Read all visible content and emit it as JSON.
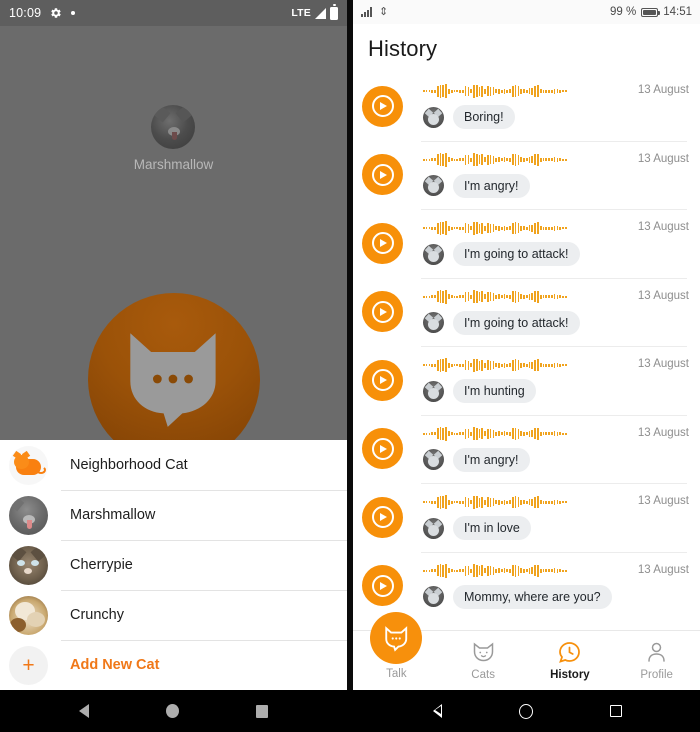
{
  "left_phone": {
    "status_bar": {
      "time": "10:09",
      "icons_left": [
        "gear-icon",
        "dot-icon"
      ],
      "network": "LTE",
      "icons_right": [
        "signal-icon",
        "battery-icon"
      ]
    },
    "hero": {
      "cat_name": "Marshmallow",
      "avatar": "cat-photo-avatar",
      "talk_button": "cat-speech-bubble-icon"
    },
    "cat_list": [
      {
        "label": "Neighborhood Cat",
        "avatar": "orange-cartoon-cat-avatar"
      },
      {
        "label": "Marshmallow",
        "avatar": "gray-cat-photo-avatar"
      },
      {
        "label": "Cherrypie",
        "avatar": "tabby-cat-photo-avatar"
      },
      {
        "label": "Crunchy",
        "avatar": "cream-cat-photo-avatar"
      }
    ],
    "add_new_cat": {
      "label": "Add New Cat",
      "icon": "plus-icon"
    }
  },
  "right_phone": {
    "status_bar": {
      "signal": "signal-bars-icon",
      "usb": "usb-icon",
      "battery_percent": "99 %",
      "battery": "battery-icon",
      "time": "14:51"
    },
    "page_title": "History",
    "history_items": [
      {
        "date": "13 August",
        "message": "Boring!",
        "play": "play-icon",
        "waveform": "audio-waveform",
        "avatar": "cat-avatar"
      },
      {
        "date": "13 August",
        "message": "I'm angry!",
        "play": "play-icon",
        "waveform": "audio-waveform",
        "avatar": "cat-avatar"
      },
      {
        "date": "13 August",
        "message": "I'm going to attack!",
        "play": "play-icon",
        "waveform": "audio-waveform",
        "avatar": "cat-avatar"
      },
      {
        "date": "13 August",
        "message": "I'm going to attack!",
        "play": "play-icon",
        "waveform": "audio-waveform",
        "avatar": "cat-avatar"
      },
      {
        "date": "13 August",
        "message": "I'm hunting",
        "play": "play-icon",
        "waveform": "audio-waveform",
        "avatar": "cat-avatar"
      },
      {
        "date": "13 August",
        "message": "I'm angry!",
        "play": "play-icon",
        "waveform": "audio-waveform",
        "avatar": "cat-avatar"
      },
      {
        "date": "13 August",
        "message": "I'm in love",
        "play": "play-icon",
        "waveform": "audio-waveform",
        "avatar": "cat-avatar"
      },
      {
        "date": "13 August",
        "message": "Mommy, where are you?",
        "play": "play-icon",
        "waveform": "audio-waveform",
        "avatar": "cat-avatar"
      }
    ],
    "bottom_nav": [
      {
        "label": "Talk",
        "icon": "cat-speech-bubble-icon",
        "active": false
      },
      {
        "label": "Cats",
        "icon": "cat-face-icon",
        "active": false
      },
      {
        "label": "History",
        "icon": "clock-speech-bubble-icon",
        "active": true
      },
      {
        "label": "Profile",
        "icon": "person-icon",
        "active": false
      }
    ]
  },
  "android_nav": {
    "left": [
      "back-icon",
      "home-icon",
      "recents-icon"
    ],
    "right": [
      "back-icon",
      "home-icon",
      "recents-icon"
    ]
  },
  "waveform_bars": [
    2,
    2,
    2,
    3,
    3,
    11,
    13,
    12,
    14,
    5,
    3,
    2,
    2,
    3,
    3,
    10,
    9,
    4,
    13,
    12,
    9,
    11,
    5,
    10,
    9,
    8,
    4,
    5,
    3,
    5,
    3,
    4,
    11,
    12,
    10,
    5,
    4,
    3,
    6,
    7,
    11,
    12,
    4,
    3,
    3,
    3,
    3,
    5,
    4,
    3,
    2,
    2
  ],
  "colors": {
    "accent_orange": "#f7900c",
    "waveform": "#f0a31e",
    "left_bg": "#6b6b6b",
    "big_button": "#9b5208",
    "chip_bg": "#eceef0"
  }
}
